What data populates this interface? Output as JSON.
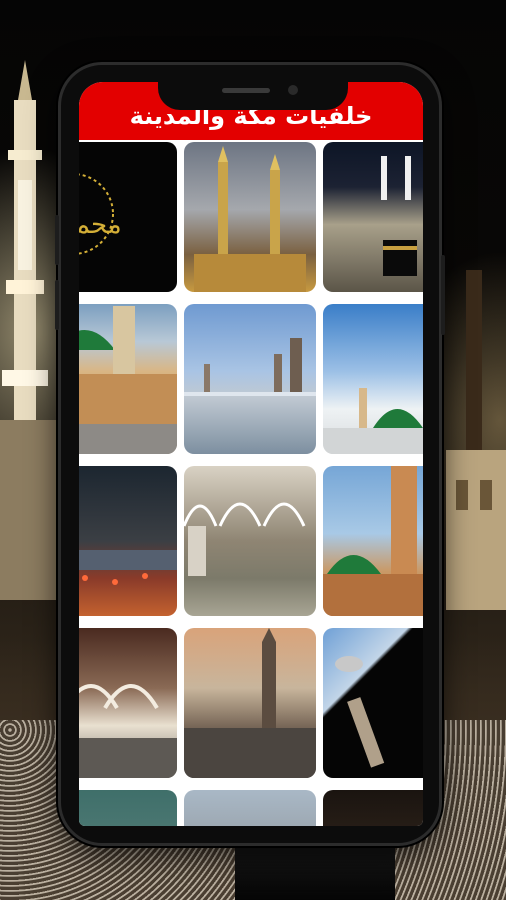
{
  "screen": {
    "title": "خلفيات مكة والمدينة"
  },
  "colors": {
    "app_bar": "#e30000",
    "dome_green": "#1f7a3a",
    "gold": "#d4af37"
  },
  "gallery": {
    "columns": 3,
    "rows_visible": 5,
    "tiles": [
      {
        "scene": "calligraphy-muhammad",
        "caption": "محمد"
      },
      {
        "scene": "masjid-minarets-dusk"
      },
      {
        "scene": "kaaba-night-crowd"
      },
      {
        "scene": "green-dome-courtyard"
      },
      {
        "scene": "masjid-plaza-umbrellas"
      },
      {
        "scene": "green-dome-blue-sky"
      },
      {
        "scene": "city-night-tower"
      },
      {
        "scene": "arched-hall-marble"
      },
      {
        "scene": "minaret-green-dome"
      },
      {
        "scene": "arched-interior-lights"
      },
      {
        "scene": "minaret-sunset"
      },
      {
        "scene": "silhouette-moon-minaret"
      },
      {
        "scene": "partial-teal"
      },
      {
        "scene": "partial-buildings"
      },
      {
        "scene": "partial-dark"
      }
    ]
  }
}
